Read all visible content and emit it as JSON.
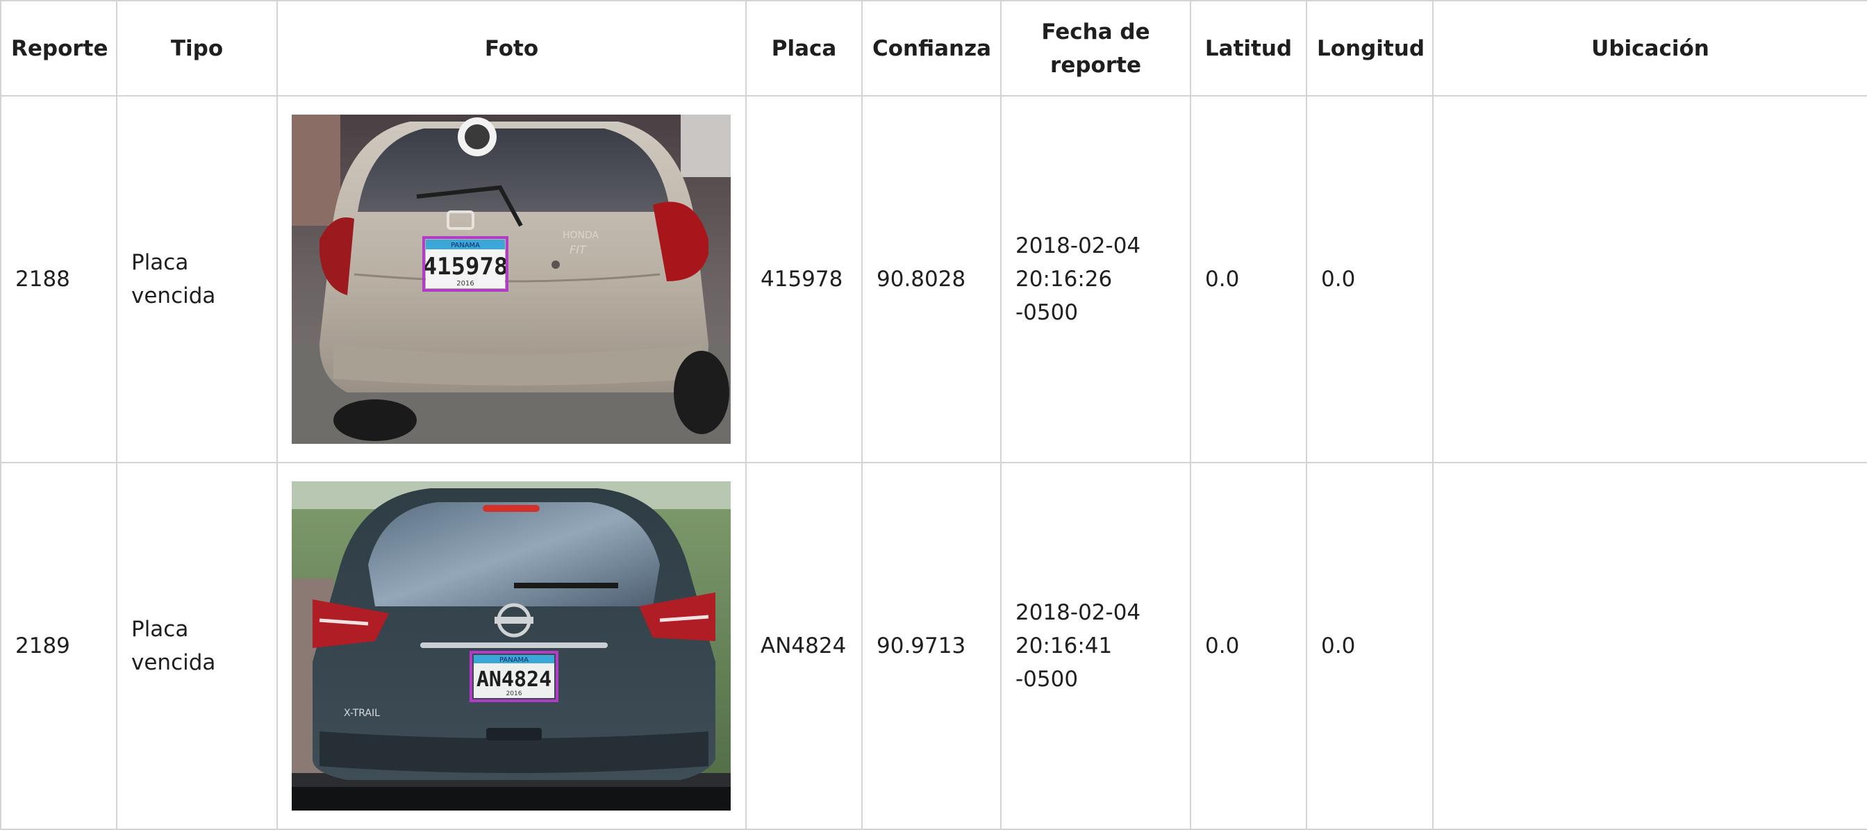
{
  "table": {
    "headers": {
      "reporte": "Reporte",
      "tipo": "Tipo",
      "foto": "Foto",
      "placa": "Placa",
      "confianza": "Confianza",
      "fecha_line1": "Fecha de",
      "fecha_line2": "reporte",
      "latitud": "Latitud",
      "longitud": "Longitud",
      "ubicacion": "Ubicación"
    },
    "rows": [
      {
        "reporte": "2188",
        "tipo_line1": "Placa",
        "tipo_line2": "vencida",
        "photo": {
          "plate_text": "415978",
          "plate_header": "PANAMA",
          "plate_year": "2016",
          "brand": "HONDA",
          "model": "FIT"
        },
        "placa": "415978",
        "confianza": "90.8028",
        "fecha_line1": "2018-02-04",
        "fecha_line2": "20:16:26 -0500",
        "latitud": "0.0",
        "longitud": "0.0",
        "ubicacion": ""
      },
      {
        "reporte": "2189",
        "tipo_line1": "Placa",
        "tipo_line2": "vencida",
        "photo": {
          "plate_text": "AN4824",
          "plate_header": "PANAMA",
          "plate_year": "2016",
          "model": "X-TRAIL"
        },
        "placa": "AN4824",
        "confianza": "90.9713",
        "fecha_line1": "2018-02-04",
        "fecha_line2": "20:16:41 -0500",
        "latitud": "0.0",
        "longitud": "0.0",
        "ubicacion": ""
      }
    ]
  },
  "colors": {
    "border": "#d4d4d4",
    "detection_box": "#b23cc8"
  }
}
